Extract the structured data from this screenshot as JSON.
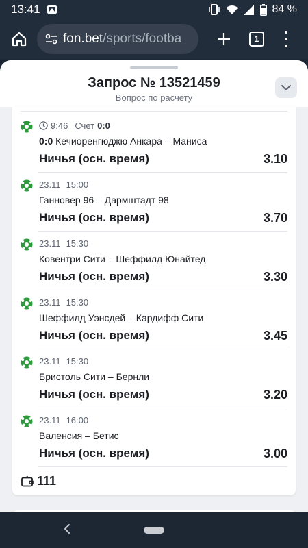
{
  "status_bar": {
    "time": "13:41",
    "battery": "84 %"
  },
  "browser": {
    "url_domain": "fon.bet",
    "url_path": "/sports/footba",
    "tab_count": "1"
  },
  "sheet": {
    "title": "Запрос № 13521459",
    "subtitle": "Вопрос по расчету"
  },
  "bets": [
    {
      "time": "9:46",
      "score_label": "Счет",
      "score_value": "0:0",
      "match_score": "0:0",
      "match": "Кечиоренгюджю Анкара – Маниса",
      "outcome": "Ничья (осн. время)",
      "odds": "3.10"
    },
    {
      "date": "23.11",
      "time": "15:00",
      "match": "Ганновер 96 – Дармштадт 98",
      "outcome": "Ничья (осн. время)",
      "odds": "3.70"
    },
    {
      "date": "23.11",
      "time": "15:30",
      "match": "Ковентри Сити – Шеффилд Юнайтед",
      "outcome": "Ничья (осн. время)",
      "odds": "3.30"
    },
    {
      "date": "23.11",
      "time": "15:30",
      "match": "Шеффилд Уэнсдей – Кардифф Сити",
      "outcome": "Ничья (осн. время)",
      "odds": "3.45"
    },
    {
      "date": "23.11",
      "time": "15:30",
      "match": "Бристоль Сити – Бернли",
      "outcome": "Ничья (осн. время)",
      "odds": "3.20"
    },
    {
      "date": "23.11",
      "time": "16:00",
      "match": "Валенсия – Бетис",
      "outcome": "Ничья (осн. время)",
      "odds": "3.00"
    }
  ],
  "footer": {
    "stake": "111"
  },
  "colors": {
    "ball_green": "#2e9a3e",
    "sheet_bg": "#eef0f3",
    "system_bar": "#222d3b"
  }
}
